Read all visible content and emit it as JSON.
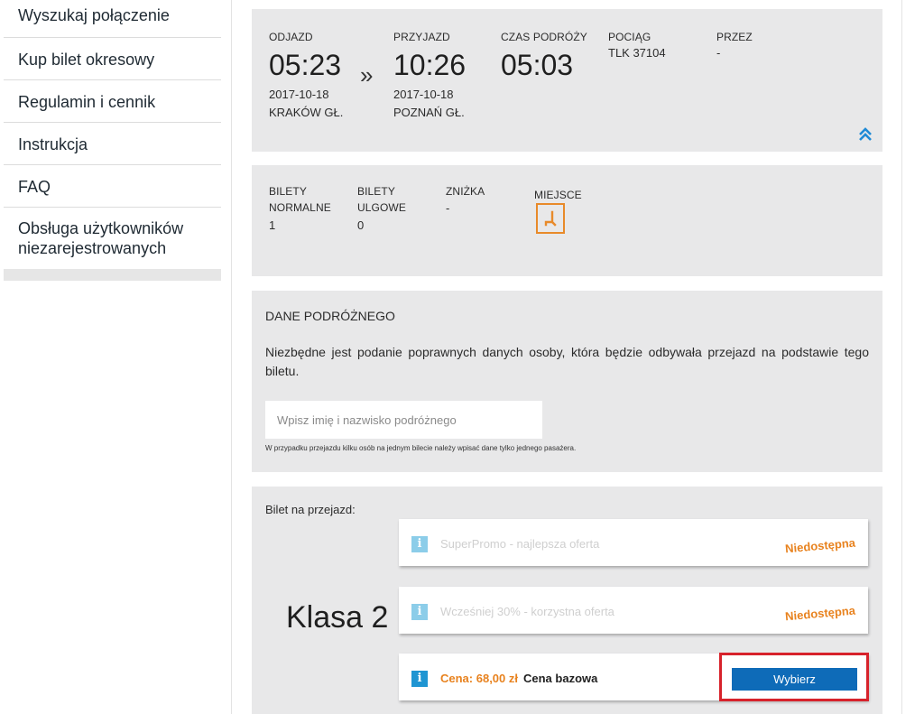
{
  "sidebar": {
    "items": [
      {
        "label": "Wyszukaj połączenie"
      },
      {
        "label": "Kup bilet okresowy"
      },
      {
        "label": "Regulamin i cennik"
      },
      {
        "label": "Instrukcja"
      },
      {
        "label": "FAQ"
      },
      {
        "label_line1": "Obsługa użytkowników",
        "label_line2": "niezarejestrowanych"
      }
    ]
  },
  "journey": {
    "departure_label": "ODJAZD",
    "departure_time": "05:23",
    "departure_date": "2017-10-18",
    "departure_station": "KRAKÓW GŁ.",
    "separator": "»",
    "arrival_label": "PRZYJAZD",
    "arrival_time": "10:26",
    "arrival_date": "2017-10-18",
    "arrival_station": "POZNAŃ GŁ.",
    "duration_label": "CZAS PODRÓŻY",
    "duration": "05:03",
    "train_label": "POCIĄG",
    "train": "TLK 37104",
    "via_label": "PRZEZ",
    "via": "-",
    "collapse_icon": "double-chevron-up-icon"
  },
  "tickets": {
    "normal_label_1": "BILETY",
    "normal_label_2": "NORMALNE",
    "normal_value": "1",
    "reduced_label_1": "BILETY",
    "reduced_label_2": "ULGOWE",
    "reduced_value": "0",
    "discount_label": "ZNIŻKA",
    "discount_value": "-",
    "seat_label": "MIEJSCE",
    "seat_icon": "seat-icon",
    "accent_color": "#e88a2a"
  },
  "traveler": {
    "heading": "DANE PODRÓŻNEGO",
    "description": "Niezbędne jest podanie poprawnych danych osoby, która będzie odbywała przejazd na podstawie tego biletu.",
    "name_placeholder": "Wpisz imię i nazwisko podróżnego",
    "name_value": "",
    "note": "W przypadku przejazdu kilku osób na jednym bilecie należy wpisać dane tylko jednego pasażera."
  },
  "fare": {
    "heading": "Bilet na przejazd:",
    "class_label": "Klasa 2",
    "offers": [
      {
        "title": "SuperPromo - najlepsza oferta",
        "status": "Niedostępna"
      },
      {
        "title": "Wcześniej 30% - korzystna oferta",
        "status": "Niedostępna"
      },
      {
        "price": "Cena: 68,00 zł",
        "type": "Cena bazowa",
        "button": "Wybierz"
      }
    ],
    "info_icon_color": "#1f95d2",
    "button_color": "#0e6bb8",
    "highlight_color": "#d7222b"
  }
}
